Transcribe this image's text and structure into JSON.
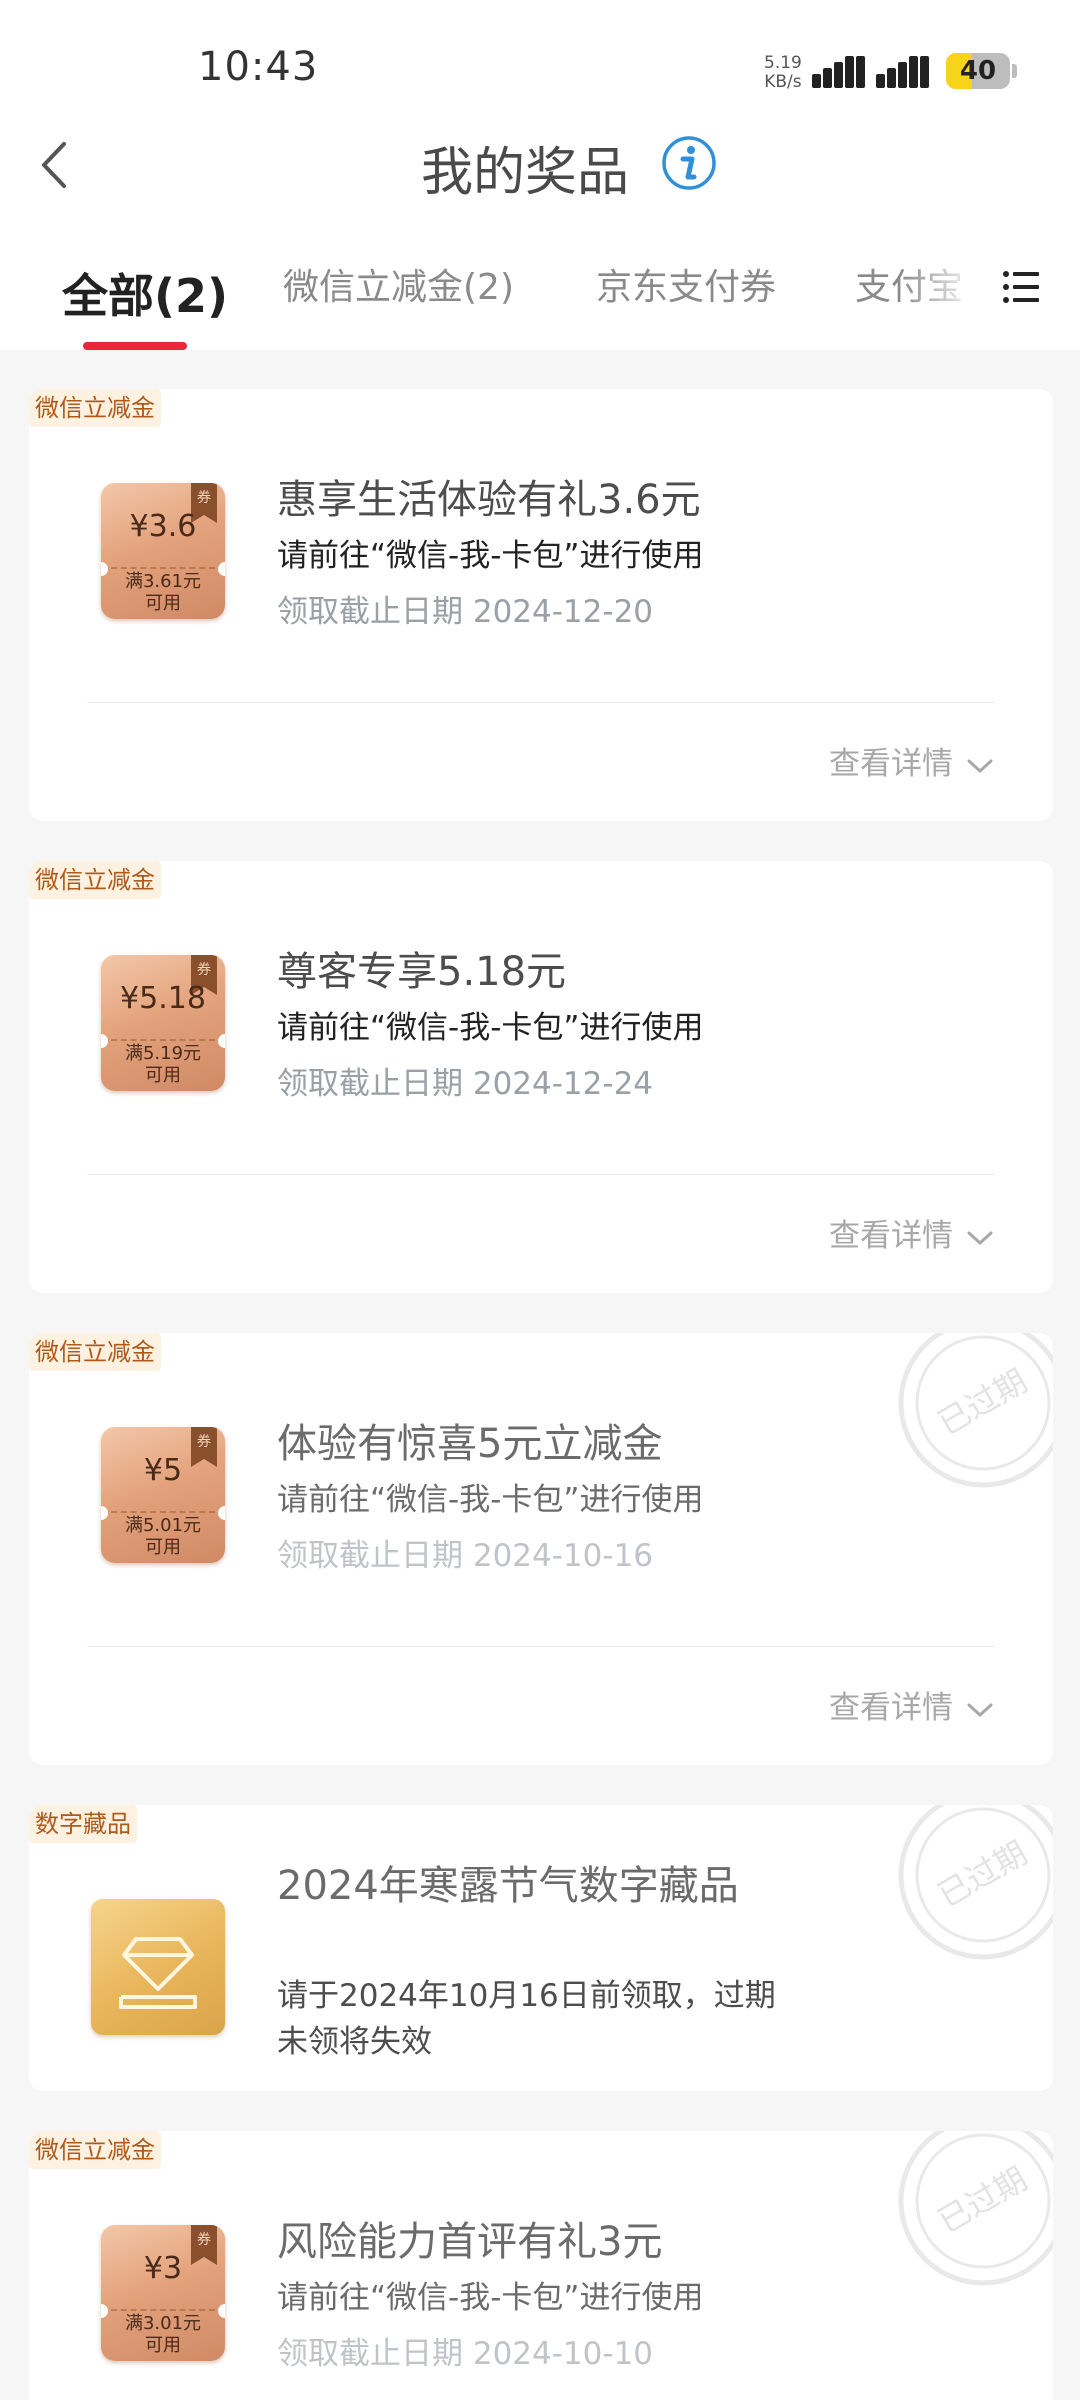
{
  "status_bar": {
    "time": "10:43",
    "net_speed_value": "5.19",
    "net_speed_unit": "KB/s",
    "battery": "40"
  },
  "header": {
    "title": "我的奖品",
    "back_icon": "chevron-left-icon",
    "info_icon": "info-icon"
  },
  "tabs": [
    {
      "label": "全部(2)",
      "active": true
    },
    {
      "label": "微信立减金(2)",
      "active": false
    },
    {
      "label": "京东支付券",
      "active": false
    },
    {
      "label": "支付宝",
      "active": false
    }
  ],
  "menu_icon": "list-menu-icon",
  "colors": {
    "accent": "#e8273a",
    "tag_text": "#b05a1a",
    "tag_bg": "#fdf1e2"
  },
  "cards": [
    {
      "tag": "微信立减金",
      "coupon_amount": "¥3.6",
      "coupon_condition_1": "满3.61元",
      "coupon_condition_2": "可用",
      "coupon_flag": "券",
      "title": "惠享生活体验有礼3.6元",
      "usage": "请前往“微信-我-卡包”进行使用",
      "date": "领取截止日期 2024-12-20",
      "detail": "查看详情",
      "expired": false
    },
    {
      "tag": "微信立减金",
      "coupon_amount": "¥5.18",
      "coupon_condition_1": "满5.19元",
      "coupon_condition_2": "可用",
      "coupon_flag": "券",
      "title": "尊客专享5.18元",
      "usage": "请前往“微信-我-卡包”进行使用",
      "date": "领取截止日期 2024-12-24",
      "detail": "查看详情",
      "expired": false
    },
    {
      "tag": "微信立减金",
      "coupon_amount": "¥5",
      "coupon_condition_1": "满5.01元",
      "coupon_condition_2": "可用",
      "coupon_flag": "券",
      "title": "体验有惊喜5元立减金",
      "usage": "请前往“微信-我-卡包”进行使用",
      "date": "领取截止日期 2024-10-16",
      "detail": "查看详情",
      "expired": true,
      "stamp": "已过期"
    },
    {
      "tag": "数字藏品",
      "title": "2024年寒露节气数字藏品",
      "note": "请于2024年10月16日前领取，过期未领将失效",
      "icon": "diamond-icon",
      "expired": true,
      "stamp": "已过期"
    },
    {
      "tag": "微信立减金",
      "coupon_amount": "¥3",
      "coupon_condition_1": "满3.01元",
      "coupon_condition_2": "可用",
      "coupon_flag": "券",
      "title": "风险能力首评有礼3元",
      "usage": "请前往“微信-我-卡包”进行使用",
      "date": "领取截止日期 2024-10-10",
      "expired": true,
      "stamp": "已过期"
    }
  ]
}
